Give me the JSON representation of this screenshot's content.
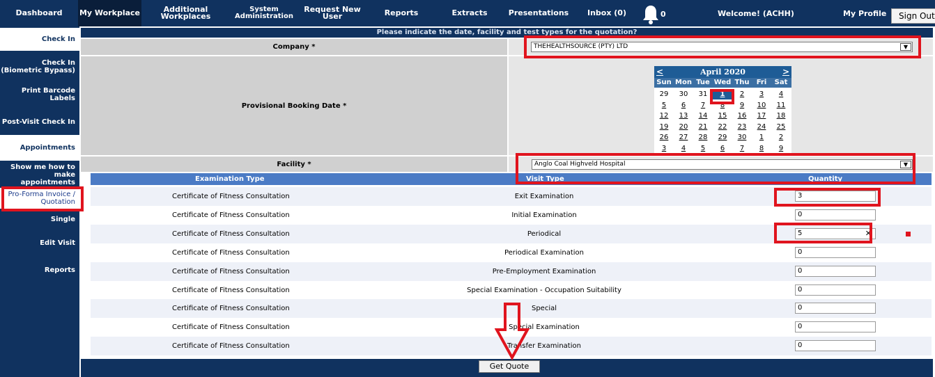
{
  "nav": {
    "dashboard": "Dashboard",
    "my_workplace": "My Workplace",
    "additional_workplaces": "Additional Workplaces",
    "system_admin_1": "System",
    "system_admin_2": "Administration",
    "request_new_user": "Request New User",
    "reports": "Reports",
    "extracts": "Extracts",
    "presentations": "Presentations",
    "inbox": "Inbox (0)",
    "notification_count": "0",
    "welcome": "Welcome! (ACHH)",
    "my_profile": "My Profile",
    "sign_out": "Sign Out"
  },
  "sidebar": {
    "items": [
      {
        "label": "Check In"
      },
      {
        "label": "Check In (Biometric Bypass)"
      },
      {
        "label": "Print Barcode Labels"
      },
      {
        "label": "Post-Visit Check In"
      },
      {
        "label": "Appointments"
      },
      {
        "label": "Show me how to make appointments"
      },
      {
        "label": "Pro-Forma Invoice / Quotation"
      },
      {
        "label": "Single"
      },
      {
        "label": "Edit Visit"
      },
      {
        "label": "Reports"
      }
    ]
  },
  "form": {
    "banner": "Please indicate the date, facility and test types for the quotation?",
    "company_label": "Company *",
    "company_value": "THEHEALTHSOURCE (PTY) LTD",
    "booking_label": "Provisional Booking Date *",
    "facility_label": "Facility *",
    "facility_value": "Anglo Coal Highveld Hospital"
  },
  "calendar": {
    "month": "April 2020",
    "prev": "<",
    "next": ">",
    "day_names": [
      "Sun",
      "Mon",
      "Tue",
      "Wed",
      "Thu",
      "Fri",
      "Sat"
    ],
    "weeks": [
      [
        "29",
        "30",
        "31",
        "1",
        "2",
        "3",
        "4"
      ],
      [
        "5",
        "6",
        "7",
        "8",
        "9",
        "10",
        "11"
      ],
      [
        "12",
        "13",
        "14",
        "15",
        "16",
        "17",
        "18"
      ],
      [
        "19",
        "20",
        "21",
        "22",
        "23",
        "24",
        "25"
      ],
      [
        "26",
        "27",
        "28",
        "29",
        "30",
        "1",
        "2"
      ],
      [
        "3",
        "4",
        "5",
        "6",
        "7",
        "8",
        "9"
      ]
    ],
    "selected": "1"
  },
  "table": {
    "headers": [
      "Examination Type",
      "Visit Type",
      "Quantity"
    ],
    "rows": [
      {
        "exam": "Certificate of Fitness Consultation",
        "visit": "Exit Examination",
        "qty": "3"
      },
      {
        "exam": "Certificate of Fitness Consultation",
        "visit": "Initial Examination",
        "qty": "0"
      },
      {
        "exam": "Certificate of Fitness Consultation",
        "visit": "Periodical",
        "qty": "5"
      },
      {
        "exam": "Certificate of Fitness Consultation",
        "visit": "Periodical Examination",
        "qty": "0"
      },
      {
        "exam": "Certificate of Fitness Consultation",
        "visit": "Pre-Employment Examination",
        "qty": "0"
      },
      {
        "exam": "Certificate of Fitness Consultation",
        "visit": "Special Examination - Occupation Suitability",
        "qty": "0"
      },
      {
        "exam": "Certificate of Fitness Consultation",
        "visit": "Special",
        "qty": "0"
      },
      {
        "exam": "Certificate of Fitness Consultation",
        "visit": "Special Examination",
        "qty": "0"
      },
      {
        "exam": "Certificate of Fitness Consultation",
        "visit": "Transfer Examination",
        "qty": "0"
      }
    ]
  },
  "actions": {
    "get_quote": "Get Quote",
    "clear_symbol": "✕",
    "dropdown_symbol": "▼"
  },
  "colors": {
    "nav_bg": "#10325f",
    "annotation_red": "#e0141e",
    "table_header": "#4b7bc5"
  }
}
